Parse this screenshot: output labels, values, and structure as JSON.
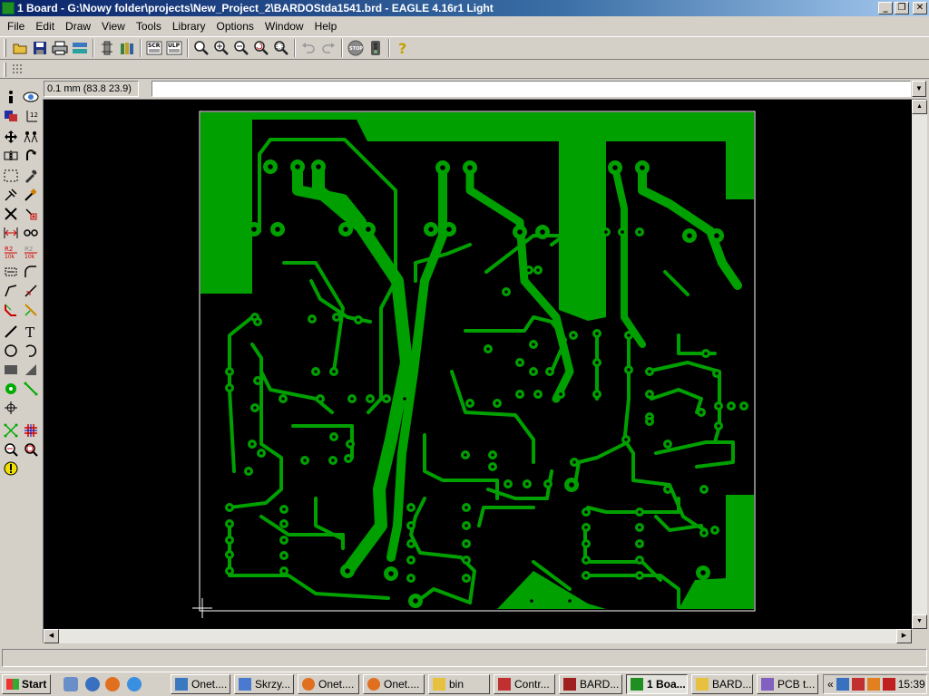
{
  "window": {
    "title": "1 Board - G:\\Nowy folder\\projects\\New_Project_2\\BARDOStda1541.brd - EAGLE 4.16r1 Light",
    "minimize": "_",
    "maximize": "❐",
    "close": "✕"
  },
  "menu": [
    "File",
    "Edit",
    "Draw",
    "View",
    "Tools",
    "Library",
    "Options",
    "Window",
    "Help"
  ],
  "toolbar": {
    "icons": [
      "open-icon",
      "save-icon",
      "print-icon",
      "cam-icon",
      "sep",
      "use-icon",
      "sep",
      "scr-icon",
      "ulp-icon",
      "sep",
      "zoom-fit-icon",
      "zoom-in-icon",
      "zoom-out-icon",
      "zoom-redraw-icon",
      "zoom-select-icon",
      "sep",
      "undo-icon",
      "redo-icon",
      "sep",
      "stop-icon",
      "go-icon",
      "sep",
      "help-icon"
    ]
  },
  "command": {
    "coordinate": "0.1 mm (83.8 23.9)",
    "value": ""
  },
  "board": {
    "background": "#000000",
    "copper": "#00a000",
    "outline": "#ffffff"
  },
  "status": {
    "text": ""
  },
  "taskbar": {
    "start": "Start",
    "tasks": [
      {
        "label": "Onet....",
        "icon": "ie-icon",
        "active": false
      },
      {
        "label": "Skrzy...",
        "icon": "mail-icon",
        "active": false
      },
      {
        "label": "Onet....",
        "icon": "firefox-icon",
        "active": false
      },
      {
        "label": "Onet....",
        "icon": "firefox-icon",
        "active": false
      },
      {
        "label": "bin",
        "icon": "folder-icon",
        "active": false
      },
      {
        "label": "Contr...",
        "icon": "control-icon",
        "active": false
      },
      {
        "label": "BARD...",
        "icon": "eagle-schematic-icon",
        "active": false
      },
      {
        "label": "1 Boa...",
        "icon": "eagle-board-icon",
        "active": true
      },
      {
        "label": "BARD...",
        "icon": "folder-icon",
        "active": false
      },
      {
        "label": "PCB t...",
        "icon": "pcb-icon",
        "active": false
      }
    ],
    "tray_arrow": "«",
    "clock": "15:39"
  }
}
